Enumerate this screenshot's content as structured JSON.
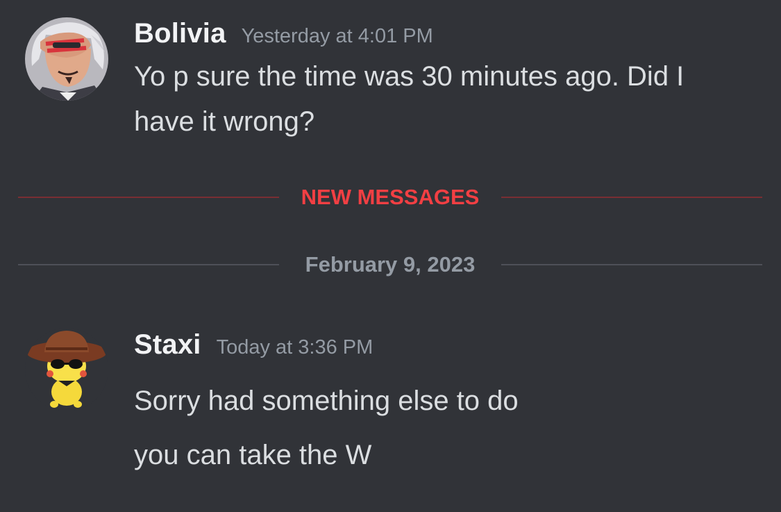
{
  "messages": [
    {
      "author": "Bolivia",
      "timestamp": "Yesterday at 4:01 PM",
      "lines": [
        "Yo p sure the time was 30 minutes ago. Did I",
        "have it wrong?"
      ],
      "avatar_icon": "anime-character-avatar"
    },
    {
      "author": "Staxi",
      "timestamp": "Today at 3:36 PM",
      "lines": [
        "Sorry had something else to do",
        "you can take the W"
      ],
      "avatar_icon": "pikachu-with-hat-avatar"
    }
  ],
  "dividers": {
    "new_messages": "NEW MESSAGES",
    "date": "February 9, 2023"
  },
  "colors": {
    "background": "#313338",
    "username": "#f2f3f5",
    "timestamp": "#949ba4",
    "message_text": "#dbdee1",
    "new_messages": "#f23f43"
  }
}
